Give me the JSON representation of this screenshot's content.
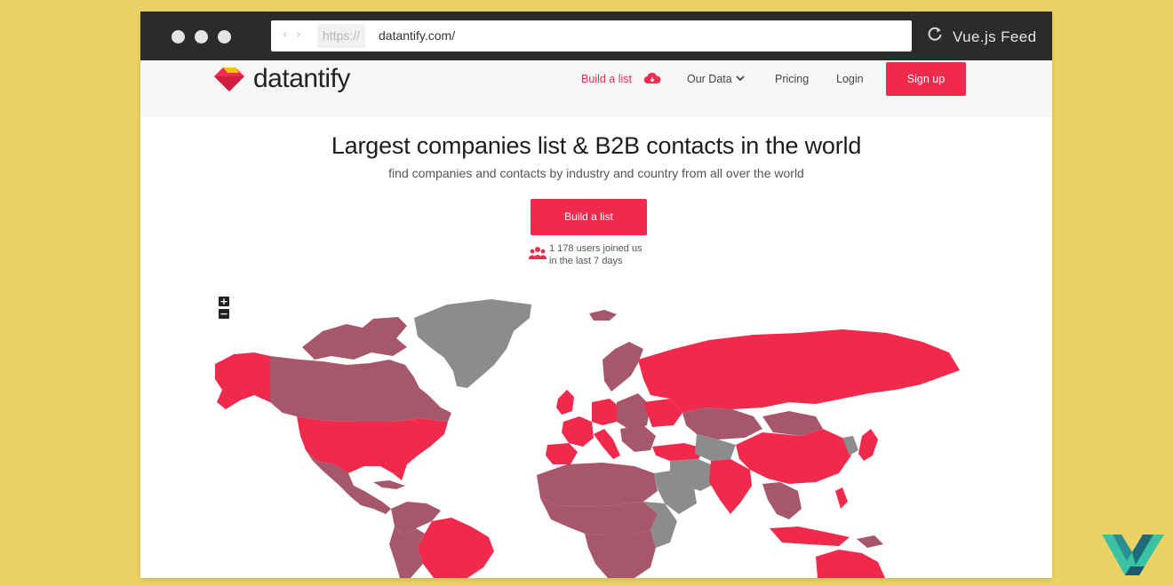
{
  "browser": {
    "scheme": "https://",
    "url": "datantify.com/",
    "brand": "Vue.js Feed"
  },
  "site": {
    "logo_text": "datantify",
    "nav": {
      "build_list": "Build a list",
      "our_data": "Our Data",
      "pricing": "Pricing",
      "login": "Login",
      "signup": "Sign up"
    }
  },
  "hero": {
    "headline": "Largest companies list & B2B contacts in the world",
    "subline": "find companies and contacts by industry and country from all over the world",
    "cta": "Build a list",
    "users_line1": "1 178 users joined us",
    "users_line2": "in the last 7 days"
  },
  "map": {
    "zoom_in": "+",
    "zoom_out": "−"
  },
  "colors": {
    "accent": "#f12a4d",
    "mid": "#a6576b",
    "gray": "#8c8c8c"
  }
}
